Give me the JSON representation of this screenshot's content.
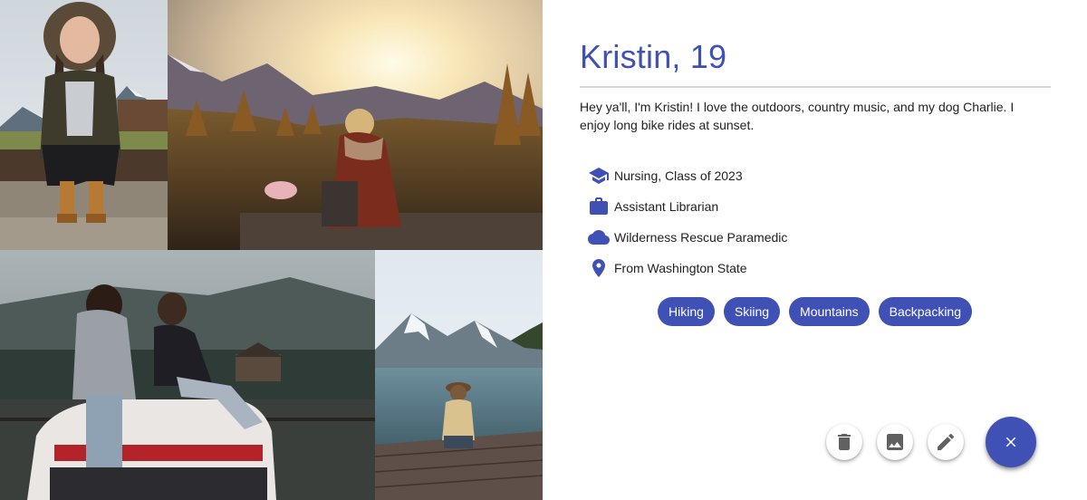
{
  "profile": {
    "name": "Kristin, 19",
    "bio": "Hey ya'll, I'm Kristin! I love the outdoors, country music, and my dog Charlie. I enjoy long bike rides at sunset.",
    "details": [
      {
        "icon": "school-icon",
        "text": "Nursing, Class of 2023"
      },
      {
        "icon": "briefcase-icon",
        "text": "Assistant Librarian"
      },
      {
        "icon": "cloud-icon",
        "text": "Wilderness Rescue Paramedic"
      },
      {
        "icon": "location-pin-icon",
        "text": "From Washington State"
      }
    ],
    "interests": [
      "Hiking",
      "Skiing",
      "Mountains",
      "Backpacking"
    ]
  },
  "photos": [
    {
      "icon": "photo-woman-fur-hood"
    },
    {
      "icon": "photo-sunset-mountains"
    },
    {
      "icon": "photo-friends-on-car"
    },
    {
      "icon": "photo-lake-dock"
    }
  ],
  "actions": {
    "delete": {
      "icon": "trash-icon"
    },
    "photo": {
      "icon": "image-icon"
    },
    "edit": {
      "icon": "pencil-icon"
    },
    "close": {
      "icon": "close-icon"
    }
  },
  "colors": {
    "accent": "#3f51b5",
    "divider": "#d6d6d6",
    "text": "#222222",
    "fab_icon": "#616161"
  }
}
